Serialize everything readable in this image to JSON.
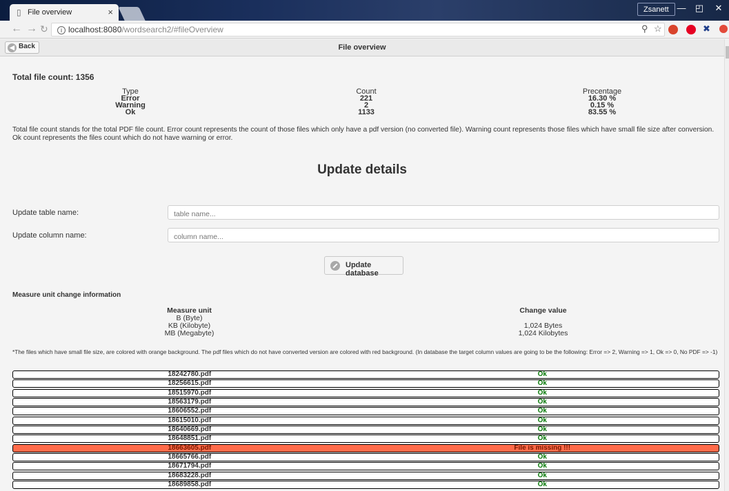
{
  "browser": {
    "tab_title": "File overview",
    "tab_close": "×",
    "profile_name": "Zsanett",
    "window_buttons": [
      "—",
      "◰",
      "✕"
    ],
    "url_host": "localhost:8080",
    "url_path": "/wordsearch2/#fileOverview",
    "icons": [
      "back-icon",
      "forward-icon",
      "reload-icon",
      "zoom-icon",
      "star-icon",
      "opera-icon",
      "pinterest-icon",
      "tools-icon",
      "record-icon"
    ],
    "ext_colors": [
      "#d9442c",
      "#e60023",
      "#e24a3a"
    ]
  },
  "header": {
    "back_label": "Back",
    "title": "File overview"
  },
  "summary": {
    "total_label": "Total file count:",
    "total_value": "1356",
    "columns": [
      "Type",
      "Count",
      "Precentage"
    ],
    "rows": [
      {
        "type": "Error",
        "count": "221",
        "percent": "16.30 %"
      },
      {
        "type": "Warning",
        "count": "2",
        "percent": "0.15 %"
      },
      {
        "type": "Ok",
        "count": "1133",
        "percent": "83.55 %"
      }
    ],
    "description": "Total file count stands for the total PDF file count. Error count represents the count of those files which only have a pdf version (no converted file). Warning count represents those files which have small file size after conversion. Ok count represents the files count which do not have warning or error."
  },
  "update": {
    "title": "Update details",
    "table_label": "Update table name:",
    "table_placeholder": "table name...",
    "column_label": "Update column name:",
    "column_placeholder": "column name...",
    "button_label": "Update database"
  },
  "measure": {
    "title": "Measure unit change information",
    "col1": "Measure unit",
    "col2": "Change value",
    "rows": [
      {
        "unit": "B (Byte)",
        "value": ""
      },
      {
        "unit": "KB (Kilobyte)",
        "value": "1,024 Bytes"
      },
      {
        "unit": "MB (Megabyte)",
        "value": "1,024 Kilobytes"
      }
    ],
    "note": "*The files which have small file size, are colored with orange background. The pdf files which do not have converted version are colored with red background. (In database the target column values are going to be the following: Error => 2, Warning => 1, Ok => 0, No PDF => -1)"
  },
  "files": [
    {
      "name": "18242780.pdf",
      "status": "Ok",
      "missing": false
    },
    {
      "name": "18256615.pdf",
      "status": "Ok",
      "missing": false
    },
    {
      "name": "18515970.pdf",
      "status": "Ok",
      "missing": false
    },
    {
      "name": "18563179.pdf",
      "status": "Ok",
      "missing": false
    },
    {
      "name": "18606552.pdf",
      "status": "Ok",
      "missing": false
    },
    {
      "name": "18615010.pdf",
      "status": "Ok",
      "missing": false
    },
    {
      "name": "18640669.pdf",
      "status": "Ok",
      "missing": false
    },
    {
      "name": "18648851.pdf",
      "status": "Ok",
      "missing": false
    },
    {
      "name": "18663605.pdf",
      "status": "File is missing !!!",
      "missing": true
    },
    {
      "name": "18665766.pdf",
      "status": "Ok",
      "missing": false
    },
    {
      "name": "18671794.pdf",
      "status": "Ok",
      "missing": false
    },
    {
      "name": "18683228.pdf",
      "status": "Ok",
      "missing": false
    },
    {
      "name": "18689858.pdf",
      "status": "Ok",
      "missing": false
    }
  ]
}
